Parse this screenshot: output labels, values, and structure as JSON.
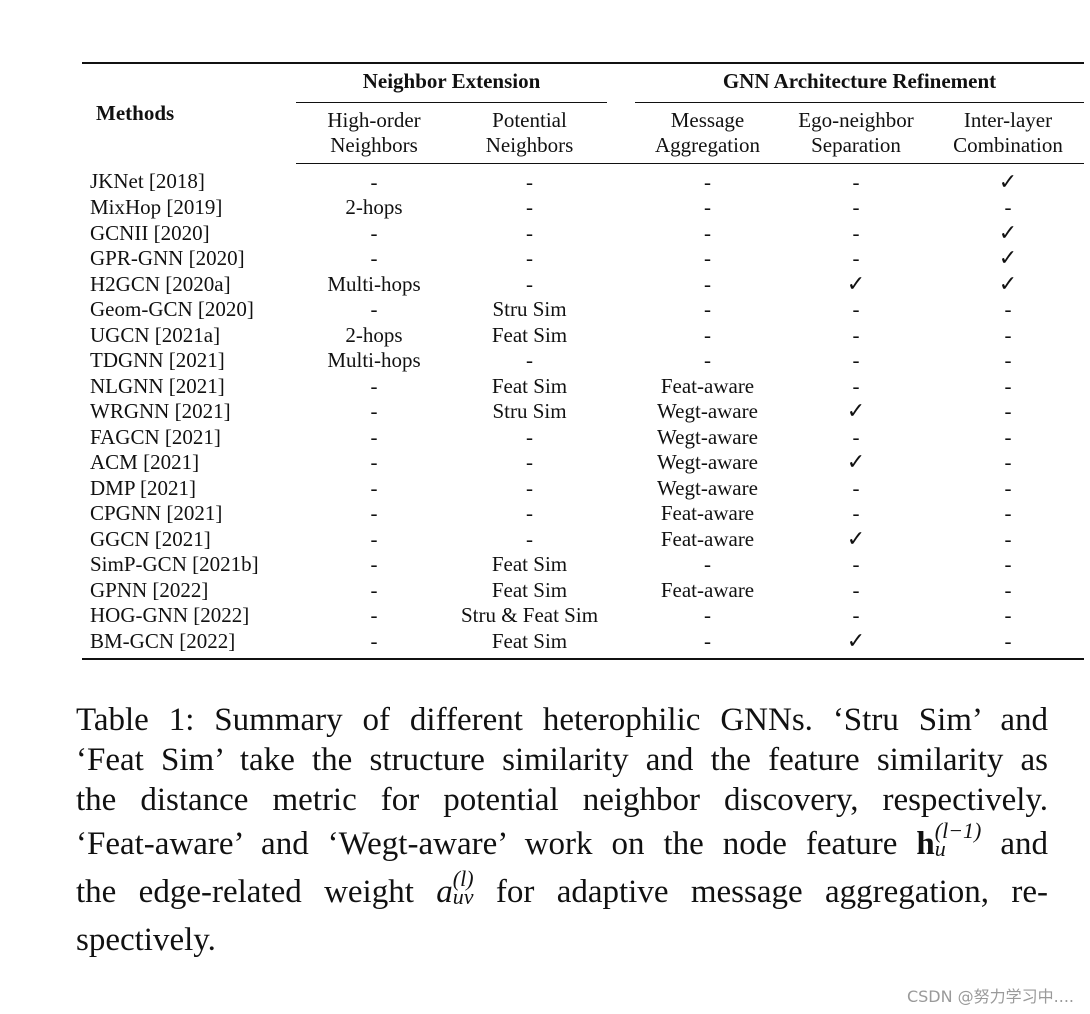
{
  "table": {
    "methods_header": "Methods",
    "groups": [
      {
        "label": "Neighbor Extension",
        "subcolumns": [
          {
            "line1": "High-order",
            "line2": "Neighbors"
          },
          {
            "line1": "Potential",
            "line2": "Neighbors"
          }
        ]
      },
      {
        "label": "GNN Architecture Refinement",
        "subcolumns": [
          {
            "line1": "Message",
            "line2": "Aggregation"
          },
          {
            "line1": "Ego-neighbor",
            "line2": "Separation"
          },
          {
            "line1": "Inter-layer",
            "line2": "Combination"
          }
        ]
      }
    ],
    "check_symbol": "✓",
    "rows": [
      {
        "method": "JKNet [2018]",
        "cells": [
          "-",
          "-",
          "-",
          "-",
          "✓"
        ]
      },
      {
        "method": "MixHop [2019]",
        "cells": [
          "2-hops",
          "-",
          "-",
          "-",
          "-"
        ]
      },
      {
        "method": "GCNII [2020]",
        "cells": [
          "-",
          "-",
          "-",
          "-",
          "✓"
        ]
      },
      {
        "method": "GPR-GNN [2020]",
        "cells": [
          "-",
          "-",
          "-",
          "-",
          "✓"
        ]
      },
      {
        "method": "H2GCN [2020a]",
        "cells": [
          "Multi-hops",
          "-",
          "-",
          "✓",
          "✓"
        ]
      },
      {
        "method": "Geom-GCN [2020]",
        "cells": [
          "-",
          "Stru Sim",
          "-",
          "-",
          "-"
        ]
      },
      {
        "method": "UGCN [2021a]",
        "cells": [
          "2-hops",
          "Feat Sim",
          "-",
          "-",
          "-"
        ]
      },
      {
        "method": "TDGNN [2021]",
        "cells": [
          "Multi-hops",
          "-",
          "-",
          "-",
          "-"
        ]
      },
      {
        "method": "NLGNN [2021]",
        "cells": [
          "-",
          "Feat Sim",
          "Feat-aware",
          "-",
          "-"
        ]
      },
      {
        "method": "WRGNN [2021]",
        "cells": [
          "-",
          "Stru Sim",
          "Wegt-aware",
          "✓",
          "-"
        ]
      },
      {
        "method": "FAGCN [2021]",
        "cells": [
          "-",
          "-",
          "Wegt-aware",
          "-",
          "-"
        ]
      },
      {
        "method": "ACM [2021]",
        "cells": [
          "-",
          "-",
          "Wegt-aware",
          "✓",
          "-"
        ]
      },
      {
        "method": "DMP [2021]",
        "cells": [
          "-",
          "-",
          "Wegt-aware",
          "-",
          "-"
        ]
      },
      {
        "method": "CPGNN [2021]",
        "cells": [
          "-",
          "-",
          "Feat-aware",
          "-",
          "-"
        ]
      },
      {
        "method": "GGCN [2021]",
        "cells": [
          "-",
          "-",
          "Feat-aware",
          "✓",
          "-"
        ]
      },
      {
        "method": "SimP-GCN [2021b]",
        "cells": [
          "-",
          "Feat Sim",
          "-",
          "-",
          "-"
        ]
      },
      {
        "method": "GPNN [2022]",
        "cells": [
          "-",
          "Feat Sim",
          "Feat-aware",
          "-",
          "-"
        ]
      },
      {
        "method": "HOG-GNN [2022]",
        "cells": [
          "-",
          "Stru & Feat Sim",
          "-",
          "-",
          "-"
        ]
      },
      {
        "method": "BM-GCN [2022]",
        "cells": [
          "-",
          "Feat Sim",
          "-",
          "✓",
          "-"
        ]
      }
    ]
  },
  "caption": {
    "line1": "Table 1: Summary of different heterophilic GNNs.  ‘Stru Sim’ and",
    "line2": "‘Feat Sim’ take the structure similarity and the feature similarity as",
    "line3": "the distance metric for potential neighbor discovery, respectively.",
    "line4_pre": "‘Feat-aware’ and ‘Wegt-aware’ work on the node feature ",
    "line4_math_base": "h",
    "line4_math_sup": "(l−1)",
    "line4_math_sub": "u",
    "line4_post": " and",
    "line5_pre": "the edge-related weight ",
    "line5_math_base": "a",
    "line5_math_sup": "(l)",
    "line5_math_sub": "uv",
    "line5_post": " for adaptive message aggregation, re-",
    "line6": "spectively."
  },
  "watermark": "CSDN @努力学习中...."
}
